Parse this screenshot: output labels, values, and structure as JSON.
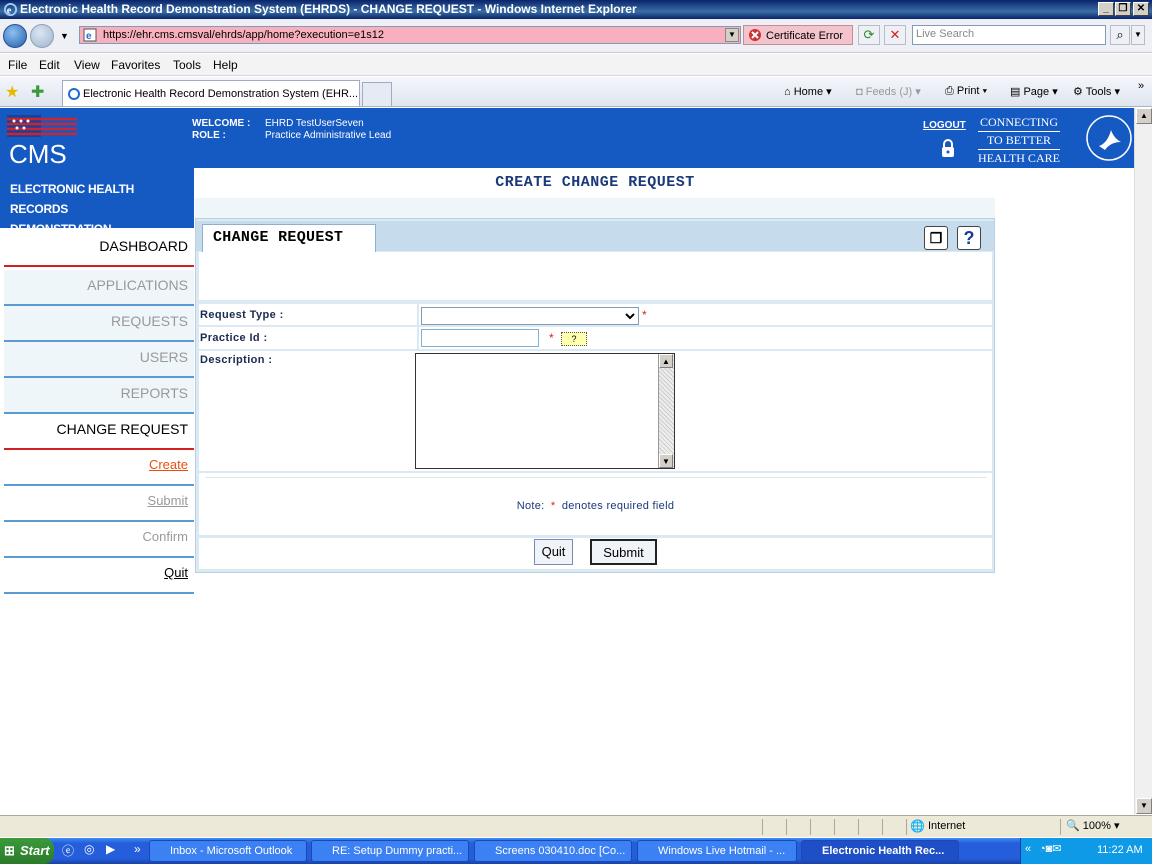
{
  "window": {
    "title": "Electronic Health Record Demonstration System (EHRDS) - CHANGE REQUEST - Windows Internet Explorer"
  },
  "browser": {
    "url": "https://ehr.cms.cmsval/ehrds/app/home?execution=e1s12",
    "cert_error": "Certificate Error",
    "search_placeholder": "Live Search",
    "menu": [
      "File",
      "Edit",
      "View",
      "Favorites",
      "Tools",
      "Help"
    ],
    "tab_title": "Electronic Health Record Demonstration System (EHR...",
    "commands": {
      "home": "Home",
      "feeds": "Feeds (J)",
      "print": "Print",
      "page": "Page",
      "tools": "Tools"
    }
  },
  "header": {
    "logo_text": "CMS",
    "welcome_label": "WELCOME :",
    "welcome_value": "EHRD TestUserSeven",
    "role_label": "ROLE :",
    "role_value": "Practice Administrative Lead",
    "logout": "LOGOUT",
    "tagline": [
      "CONNECTING",
      "TO BETTER",
      "HEALTH CARE"
    ]
  },
  "sidebar": {
    "title_line1": "ELECTRONIC HEALTH RECORDS",
    "title_line2": "DEMONSTRATION",
    "items": [
      {
        "label": "DASHBOARD"
      },
      {
        "label": "APPLICATIONS"
      },
      {
        "label": "REQUESTS"
      },
      {
        "label": "USERS"
      },
      {
        "label": "REPORTS"
      },
      {
        "label": "CHANGE REQUEST"
      },
      {
        "label": "Create"
      },
      {
        "label": "Submit"
      },
      {
        "label": "Confirm"
      },
      {
        "label": "Quit"
      }
    ]
  },
  "main": {
    "page_title": "CREATE CHANGE REQUEST",
    "panel_title": "CHANGE REQUEST",
    "fields": {
      "request_type_label": "Request Type :",
      "request_type_value": "",
      "practice_id_label": "Practice Id :",
      "practice_id_value": "",
      "practice_id_help": "?",
      "description_label": "Description :",
      "description_value": ""
    },
    "required_mark": "*",
    "note_prefix": "Note:",
    "note_star": "*",
    "note_text": "denotes required field",
    "buttons": {
      "quit": "Quit",
      "submit": "Submit"
    }
  },
  "statusbar": {
    "zone": "Internet",
    "zoom": "100%"
  },
  "taskbar": {
    "start": "Start",
    "items": [
      "Inbox - Microsoft Outlook",
      "RE: Setup Dummy practi...",
      "Screens 030410.doc [Co...",
      "Windows Live Hotmail - ...",
      "Electronic Health Rec..."
    ],
    "clock": "11:22 AM"
  }
}
